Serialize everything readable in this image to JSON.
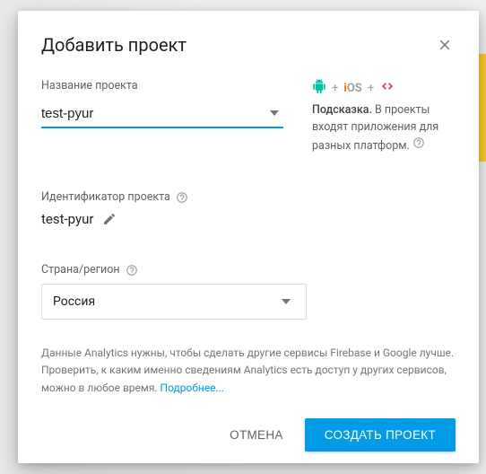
{
  "dialog": {
    "title": "Добавить проект"
  },
  "fields": {
    "project_name": {
      "label": "Название проекта",
      "value": "test-pyur"
    },
    "project_id": {
      "label": "Идентификатор проекта",
      "value": "test-pyur"
    },
    "region": {
      "label": "Страна/регион",
      "value": "Россия"
    }
  },
  "hint": {
    "bold": "Подсказка.",
    "text": " В проекты входят приложения для разных платформ."
  },
  "platform_plus": "+",
  "ios_label": "iOS",
  "analytics": {
    "text": "Данные Analytics нужны, чтобы сделать другие сервисы Firebase и Google лучше. Проверить, к каким именно сведениям Analytics есть доступ у других сервисов, можно в любое время. ",
    "link": "Подробнее..."
  },
  "actions": {
    "cancel": "ОТМЕНА",
    "create": "СОЗДАТЬ ПРОЕКТ"
  }
}
